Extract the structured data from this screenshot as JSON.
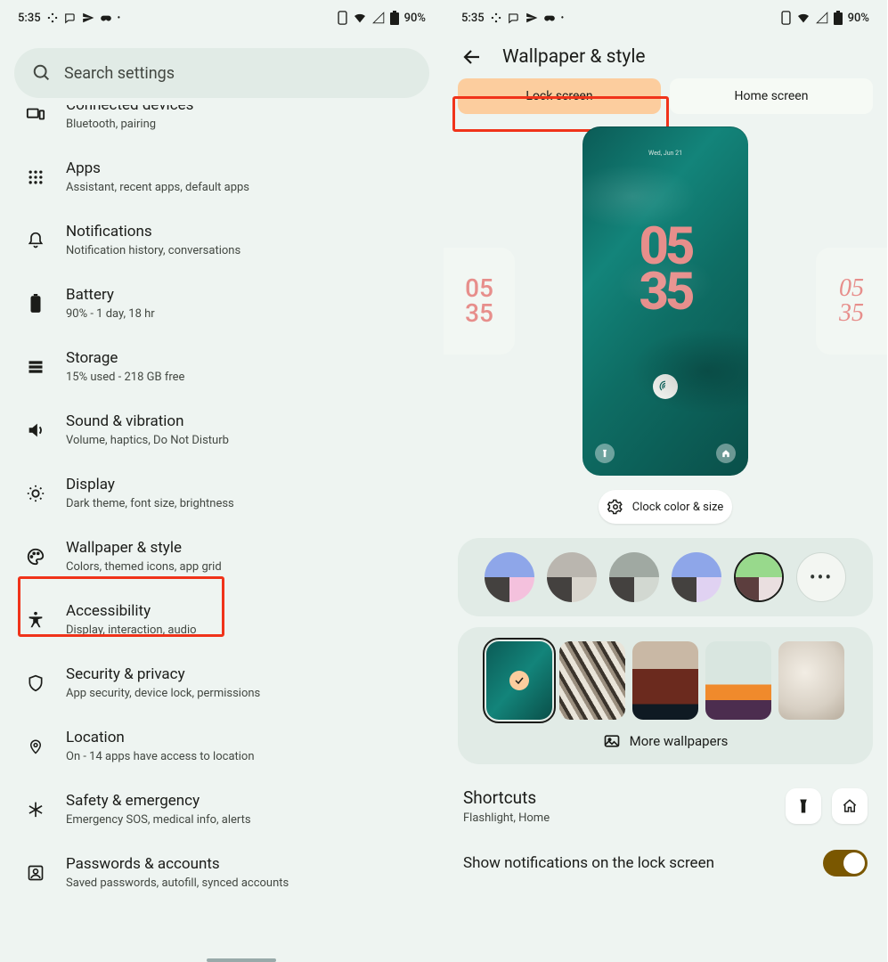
{
  "status": {
    "time": "5:35",
    "battery": "90%"
  },
  "left": {
    "search_placeholder": "Search settings",
    "items": [
      {
        "icon": "devices-icon",
        "title": "Connected devices",
        "subtitle": "Bluetooth, pairing"
      },
      {
        "icon": "apps-icon",
        "title": "Apps",
        "subtitle": "Assistant, recent apps, default apps"
      },
      {
        "icon": "bell-icon",
        "title": "Notifications",
        "subtitle": "Notification history, conversations"
      },
      {
        "icon": "battery-icon",
        "title": "Battery",
        "subtitle": "90% - 1 day, 18 hr"
      },
      {
        "icon": "storage-icon",
        "title": "Storage",
        "subtitle": "15% used - 218 GB free"
      },
      {
        "icon": "sound-icon",
        "title": "Sound & vibration",
        "subtitle": "Volume, haptics, Do Not Disturb"
      },
      {
        "icon": "display-icon",
        "title": "Display",
        "subtitle": "Dark theme, font size, brightness"
      },
      {
        "icon": "palette-icon",
        "title": "Wallpaper & style",
        "subtitle": "Colors, themed icons, app grid"
      },
      {
        "icon": "accessibility-icon",
        "title": "Accessibility",
        "subtitle": "Display, interaction, audio"
      },
      {
        "icon": "shield-icon",
        "title": "Security & privacy",
        "subtitle": "App security, device lock, permissions"
      },
      {
        "icon": "location-icon",
        "title": "Location",
        "subtitle": "On - 14 apps have access to location"
      },
      {
        "icon": "asterisk-icon",
        "title": "Safety & emergency",
        "subtitle": "Emergency SOS, medical info, alerts"
      },
      {
        "icon": "person-box-icon",
        "title": "Passwords & accounts",
        "subtitle": "Saved passwords, autofill, synced accounts"
      }
    ]
  },
  "right": {
    "header": "Wallpaper & style",
    "tabs": {
      "lock": "Lock screen",
      "home": "Home screen"
    },
    "preview": {
      "side_clock": "05\n35",
      "date": "Wed, Jun 21",
      "big1": "05",
      "big2": "35"
    },
    "clock_chip": "Clock color & size",
    "palettes": [
      {
        "tl": "#8ea6e9",
        "tr": "#8ea6e9",
        "bl": "#44413f",
        "br": "#f4c1dd",
        "selected": false
      },
      {
        "tl": "#bab6af",
        "tr": "#bab6af",
        "bl": "#44413f",
        "br": "#d9d5cd",
        "selected": false
      },
      {
        "tl": "#a0a9a2",
        "tr": "#a0a9a2",
        "bl": "#44413f",
        "br": "#d2d8d1",
        "selected": false
      },
      {
        "tl": "#8ea6e9",
        "tr": "#8ea6e9",
        "bl": "#44413f",
        "br": "#e0d2f2",
        "selected": false
      },
      {
        "tl": "#98d98c",
        "tr": "#98d98c",
        "bl": "#5c3e3e",
        "br": "#eadfe0",
        "selected": true
      }
    ],
    "more_wallpapers": "More wallpapers",
    "shortcuts": {
      "title": "Shortcuts",
      "subtitle": "Flashlight, Home"
    },
    "notifications_label": "Show notifications on the lock screen"
  }
}
